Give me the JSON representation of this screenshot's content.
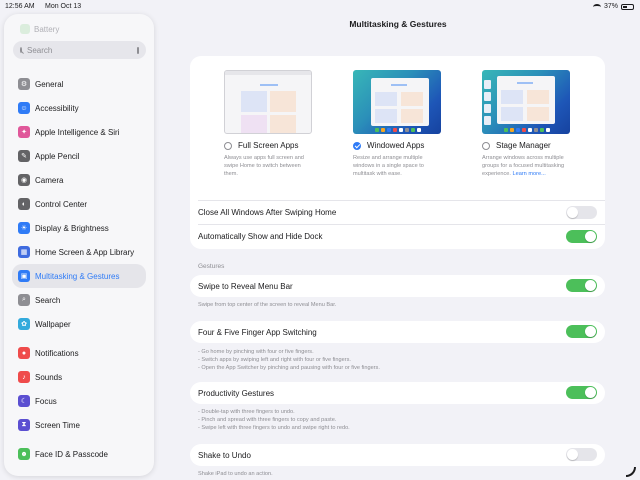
{
  "status_bar": {
    "time": "12:56 AM",
    "date": "Mon Oct 13",
    "battery": "37%"
  },
  "sidebar": {
    "header_faded": "Battery",
    "search_placeholder": "Search",
    "items": [
      {
        "label": "General",
        "icon": "gear-icon",
        "color": "#8e8e93",
        "glyph": "⚙"
      },
      {
        "label": "Accessibility",
        "icon": "accessibility-icon",
        "color": "#2f7bf6",
        "glyph": "☺"
      },
      {
        "label": "Apple Intelligence & Siri",
        "icon": "apple-intelligence-icon",
        "color": "#e0579a",
        "glyph": "✦"
      },
      {
        "label": "Apple Pencil",
        "icon": "pencil-icon",
        "color": "#636366",
        "glyph": "✎"
      },
      {
        "label": "Camera",
        "icon": "camera-icon",
        "color": "#636366",
        "glyph": "◉"
      },
      {
        "label": "Control Center",
        "icon": "control-center-icon",
        "color": "#636366",
        "glyph": "◐"
      },
      {
        "label": "Display & Brightness",
        "icon": "brightness-icon",
        "color": "#2f7bf6",
        "glyph": "☀"
      },
      {
        "label": "Home Screen & App Library",
        "icon": "home-screen-icon",
        "color": "#3f6bdf",
        "glyph": "▦"
      },
      {
        "label": "Multitasking & Gestures",
        "icon": "multitasking-icon",
        "color": "#2f7bf6",
        "glyph": "▣"
      },
      {
        "label": "Search",
        "icon": "search-icon",
        "color": "#8e8e93",
        "glyph": "⌕"
      },
      {
        "label": "Wallpaper",
        "icon": "wallpaper-icon",
        "color": "#33aadc",
        "glyph": "✿"
      },
      {
        "label": "Notifications",
        "icon": "notifications-icon",
        "color": "#ef4b4b",
        "glyph": "●"
      },
      {
        "label": "Sounds",
        "icon": "sounds-icon",
        "color": "#ef4b4b",
        "glyph": "♪"
      },
      {
        "label": "Focus",
        "icon": "focus-icon",
        "color": "#5b4fd1",
        "glyph": "☾"
      },
      {
        "label": "Screen Time",
        "icon": "screen-time-icon",
        "color": "#5b4fd1",
        "glyph": "⧗"
      },
      {
        "label": "Face ID & Passcode",
        "icon": "face-id-icon",
        "color": "#4cbf5a",
        "glyph": "☻"
      }
    ]
  },
  "main": {
    "title": "Multitasking & Gestures",
    "modes": [
      {
        "label": "Full Screen Apps",
        "desc": "Always use apps full screen and swipe Home to switch between them.",
        "selected": false
      },
      {
        "label": "Windowed Apps",
        "desc": "Resize and arrange multiple windows in a single space to multitask with ease.",
        "selected": true
      },
      {
        "label": "Stage Manager",
        "desc": "Arrange windows across multiple groups for a focused multitasking experience.",
        "link": "Learn more...",
        "selected": false
      }
    ],
    "close_all": {
      "label": "Close All Windows After Swiping Home",
      "on": false
    },
    "auto_dock": {
      "label": "Automatically Show and Hide Dock",
      "on": true
    },
    "gestures_header": "Gestures",
    "swipe_menu": {
      "label": "Swipe to Reveal Menu Bar",
      "on": true,
      "footer": "Swipe from top center of the screen to reveal Menu Bar."
    },
    "four_five": {
      "label": "Four & Five Finger App Switching",
      "on": true,
      "footer": [
        "- Go home by pinching with four or five fingers.",
        "- Switch apps by swiping left and right with four or five fingers.",
        "- Open the App Switcher by pinching and pausing with four or five fingers."
      ]
    },
    "productivity": {
      "label": "Productivity Gestures",
      "on": true,
      "footer": [
        "- Double-tap with three fingers to undo.",
        "- Pinch and spread with three fingers to copy and paste.",
        "- Swipe left with three fingers to undo and swipe right to redo."
      ]
    },
    "shake": {
      "label": "Shake to Undo",
      "on": false,
      "footer": "Shake iPad to undo an action."
    }
  }
}
